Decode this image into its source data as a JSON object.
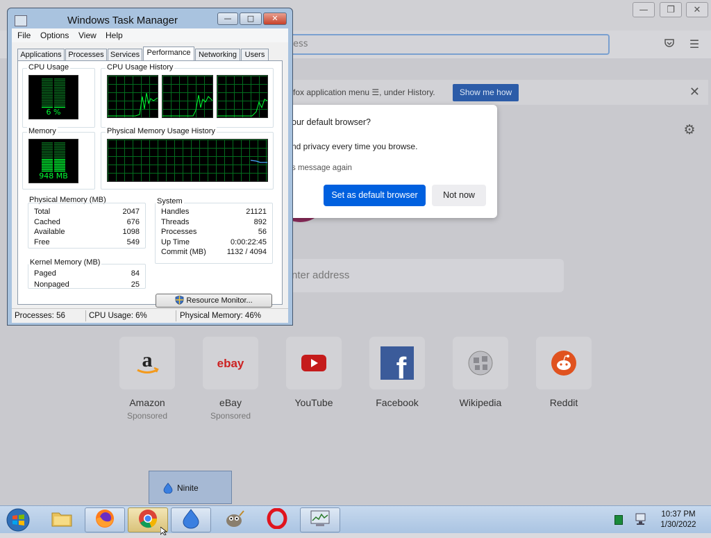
{
  "firefox": {
    "urlbar_partial": "ess",
    "notice_text": "fox application menu ☰, under History.",
    "notice_button": "Show me how",
    "dialog": {
      "title_partial": "our default browser?",
      "body_partial": "nd privacy every time you browse.",
      "checkbox_partial": "s message again",
      "primary_button": "Set as default browser",
      "secondary_button": "Not now"
    },
    "search_placeholder_partial": "nter address",
    "top_sites": [
      {
        "name": "Amazon",
        "sub": "Sponsored",
        "icon": "amazon-icon"
      },
      {
        "name": "eBay",
        "sub": "Sponsored",
        "icon": "ebay-icon"
      },
      {
        "name": "YouTube",
        "sub": "",
        "icon": "youtube-icon"
      },
      {
        "name": "Facebook",
        "sub": "",
        "icon": "facebook-icon"
      },
      {
        "name": "Wikipedia",
        "sub": "",
        "icon": "wikipedia-icon"
      },
      {
        "name": "Reddit",
        "sub": "",
        "icon": "reddit-icon"
      }
    ],
    "ebay_logo": "ebay",
    "amazon_logo": "a",
    "facebook_logo": "f"
  },
  "taskmanager": {
    "title": "Windows Task Manager",
    "menu": [
      "File",
      "Options",
      "View",
      "Help"
    ],
    "tabs": [
      "Applications",
      "Processes",
      "Services",
      "Performance",
      "Networking",
      "Users"
    ],
    "active_tab": "Performance",
    "cpu_label": "CPU Usage",
    "cpu_value": "6 %",
    "cpu_fraction": 0.06,
    "cpu_history_label": "CPU Usage History",
    "memory_label": "Memory",
    "memory_value": "948 MB",
    "memory_fraction": 0.46,
    "mem_history_label": "Physical Memory Usage History",
    "physical_memory": {
      "label": "Physical Memory (MB)",
      "rows": [
        {
          "k": "Total",
          "v": "2047"
        },
        {
          "k": "Cached",
          "v": "676"
        },
        {
          "k": "Available",
          "v": "1098"
        },
        {
          "k": "Free",
          "v": "549"
        }
      ]
    },
    "kernel_memory": {
      "label": "Kernel Memory (MB)",
      "rows": [
        {
          "k": "Paged",
          "v": "84"
        },
        {
          "k": "Nonpaged",
          "v": "25"
        }
      ]
    },
    "system": {
      "label": "System",
      "rows": [
        {
          "k": "Handles",
          "v": "21121"
        },
        {
          "k": "Threads",
          "v": "892"
        },
        {
          "k": "Processes",
          "v": "56"
        },
        {
          "k": "Up Time",
          "v": "0:00:22:45"
        },
        {
          "k": "Commit (MB)",
          "v": "1132 / 4094"
        }
      ]
    },
    "resource_monitor_button": "Resource Monitor...",
    "status": {
      "processes": "Processes: 56",
      "cpu": "CPU Usage: 6%",
      "memory": "Physical Memory: 46%"
    }
  },
  "tooltip": {
    "label": "Ninite"
  },
  "taskbar": {
    "time": "10:37 PM",
    "date": "1/30/2022"
  },
  "colors": {
    "graph_green": "#00ff33",
    "graph_grid": "#036d1e",
    "firefox_blue": "#0060df"
  }
}
